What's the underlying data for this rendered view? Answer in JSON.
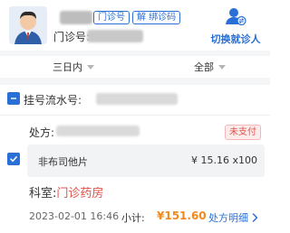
{
  "header": {
    "tag_clinic": "门诊号",
    "tag_binding": "解 绑诊码",
    "card_label": "门诊号:",
    "switch_label": "切换就诊人"
  },
  "filters": {
    "time_value": "三日内",
    "scope_value": "全部"
  },
  "registration": {
    "label": "挂号流水号:"
  },
  "prescription": {
    "label": "处方:",
    "status": "未支付",
    "item_name": "非布司他片",
    "item_price": "¥ 15.16 x100"
  },
  "department": {
    "label": "科室:",
    "value": "门诊药房"
  },
  "footer": {
    "datetime": "2023-02-01 16:46",
    "subtotal_label": "小计:",
    "subtotal_value": "¥151.60",
    "detail_link": "处方明细"
  },
  "colors": {
    "accent": "#2a6fd6",
    "warning": "#e0524a",
    "amount": "#f08a1c"
  }
}
